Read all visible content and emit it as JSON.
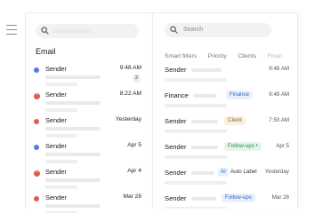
{
  "sidebar": {
    "menu_icon": "hamburger-icon"
  },
  "left_panel": {
    "search": {
      "icon": "search-icon"
    },
    "title": "Email",
    "messages": [
      {
        "sender": "Sender",
        "time": "9:48 AM",
        "indicator": "unread-dot",
        "indicator_color": "#4c7fe6",
        "count": "2"
      },
      {
        "sender": "Sender",
        "time": "8:22 AM",
        "indicator": "important-icon",
        "indicator_color": "#e25b4b",
        "count": ""
      },
      {
        "sender": "Sender",
        "time": "Yesterday",
        "indicator": "red-dot",
        "indicator_color": "#e25b4b",
        "count": ""
      },
      {
        "sender": "Sender",
        "time": "Apr 5",
        "indicator": "unread-dot",
        "indicator_color": "#4c7fe6",
        "count": ""
      },
      {
        "sender": "Sender",
        "time": "Apr 4",
        "indicator": "important-icon",
        "indicator_color": "#e25b4b",
        "count": ""
      },
      {
        "sender": "Sender",
        "time": "Mar 28",
        "indicator": "red-dot",
        "indicator_color": "#e25b4b",
        "count": ""
      }
    ]
  },
  "right_panel": {
    "search": {
      "icon": "search-icon",
      "placeholder": "Search"
    },
    "filters": [
      "Smart filters",
      "Priority",
      "Clients",
      "Finan"
    ],
    "rows": [
      {
        "sender": "Sender",
        "label": "",
        "time": "9:48 AM"
      },
      {
        "sender": "Finance",
        "label": "Finance",
        "label_color": "#2f62c7",
        "time": "9:48 AM"
      },
      {
        "sender": "Sender",
        "label": "Client",
        "label_color": "#8a6a24",
        "time": "7:50 AM"
      },
      {
        "sender": "Sender",
        "label": "Follow-ups •",
        "label_color": "#2f8a4a",
        "time": "Apr 5"
      },
      {
        "sender": "Sender",
        "ai_tag": "AI",
        "label": "Auto Label",
        "time": "Yesterday"
      },
      {
        "sender": "Sender",
        "label": "Follow-ups",
        "label_color": "#2f62c7",
        "time": "Mar 28"
      }
    ]
  }
}
